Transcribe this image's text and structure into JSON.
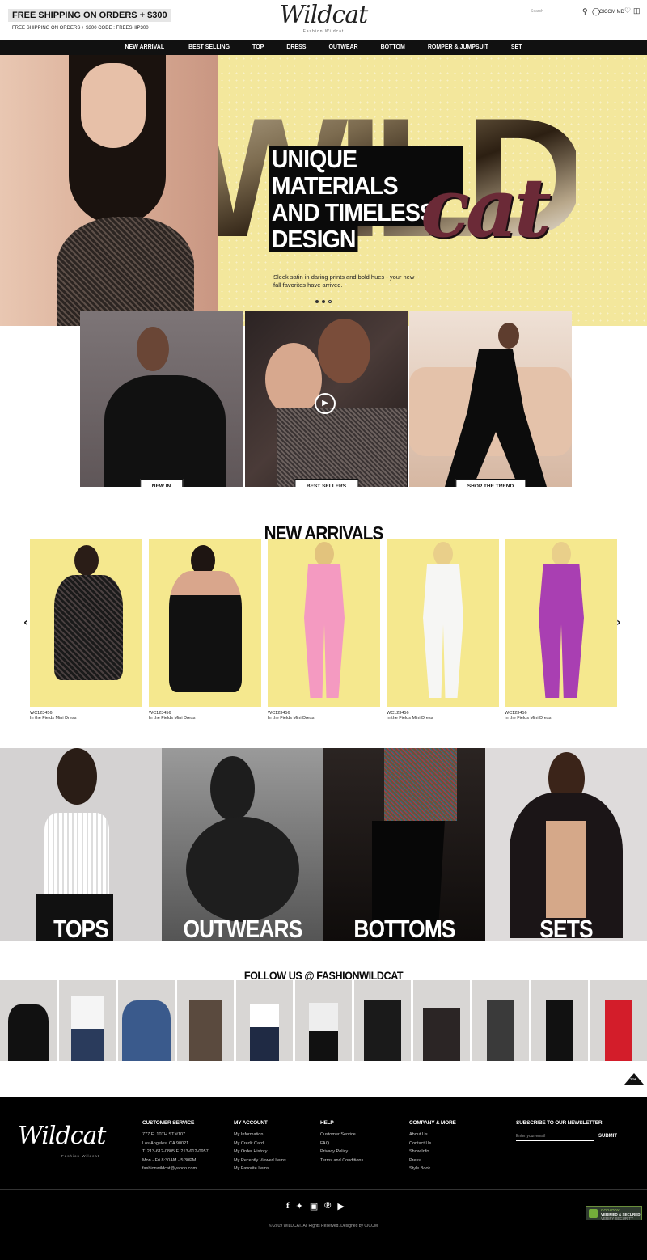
{
  "header": {
    "promo_title": "FREE SHIPPING ON ORDERS + $300",
    "promo_sub": "FREE SHIPPING ON ORDERS + $300 CODE : FREESHIP300",
    "logo": "Wildcat",
    "logo_sub": "Fashion Wildcat",
    "search_placeholder": "Search",
    "account_label": "CICOM MD"
  },
  "nav": [
    "NEW ARRIVAL",
    "BEST SELLING",
    "TOP",
    "DRESS",
    "OUTWEAR",
    "BOTTOM",
    "ROMPER & JUMPSUIT",
    "SET"
  ],
  "hero": {
    "big_word": "WILD",
    "script_word": "cat",
    "headline": [
      "UNIQUE MATERIALS",
      "AND TIMELESS",
      "DESIGN"
    ],
    "text": "Sleek satin in daring prints and bold hues - your new fall favorites have arrived."
  },
  "features": [
    {
      "label": "NEW IN"
    },
    {
      "label": "BEST SELLERS"
    },
    {
      "label": "SHOP THE TREND"
    }
  ],
  "new_arrivals": {
    "title": "NEW ARRIVALS",
    "products": [
      {
        "code": "WC123456",
        "name": "In the Fields Mini Dress",
        "color": "#1a1a1a"
      },
      {
        "code": "WC123456",
        "name": "In the Fields Mini Dress",
        "color": "#111111"
      },
      {
        "code": "WC123456",
        "name": "In the Fields Mini Dress",
        "color": "#f49ac1"
      },
      {
        "code": "WC123456",
        "name": "In the Fields Mini Dress",
        "color": "#f4f4f2"
      },
      {
        "code": "WC123456",
        "name": "In the Fields Mini Dress",
        "color": "#a93fb2"
      }
    ]
  },
  "categories": [
    {
      "label": "TOPS"
    },
    {
      "label": "OUTWEARS"
    },
    {
      "label": "BOTTOMS"
    },
    {
      "label": "SETS"
    }
  ],
  "follow": {
    "title": "FOLLOW US @ FASHIONWILDCAT"
  },
  "top_label": "TOP",
  "footer": {
    "logo": "Wildcat",
    "logo_sub": "Fashion Wildcat",
    "customer_service": {
      "title": "CUSTOMER SERVICE",
      "lines": [
        "777 E. 10TH ST #107",
        "Los Angeles, CA 90021",
        "T. 213-612-0805  F. 213-612-0957",
        "Mon - Fri 8:30AM - 5:30PM",
        "fashionwildcat@yahoo.com"
      ]
    },
    "my_account": {
      "title": "MY ACCOUNT",
      "lines": [
        "My Information",
        "My Credit Card",
        "My Order History",
        "My Recently Viewed Items",
        "My Favorite Items"
      ]
    },
    "help": {
      "title": "HELP",
      "lines": [
        "Customer Service",
        "FAQ",
        "Privacy Policy",
        "Terms and Conditions"
      ]
    },
    "company": {
      "title": "COMPANY & MORE",
      "lines": [
        "About Us",
        "Contact Us",
        "Show Info",
        "Press",
        "Style Book"
      ]
    },
    "newsletter": {
      "title": "SUBSCRIBE TO OUR NEWSLETTER",
      "placeholder": "Enter your email",
      "button": "SUBMIT"
    },
    "copyright": "© 2019 WILDCAT. All Rights Reserved. Designed by CICOM",
    "badge": [
      "GODADDY",
      "VERIFIED & SECURED",
      "VERIFY SECURITY"
    ]
  }
}
